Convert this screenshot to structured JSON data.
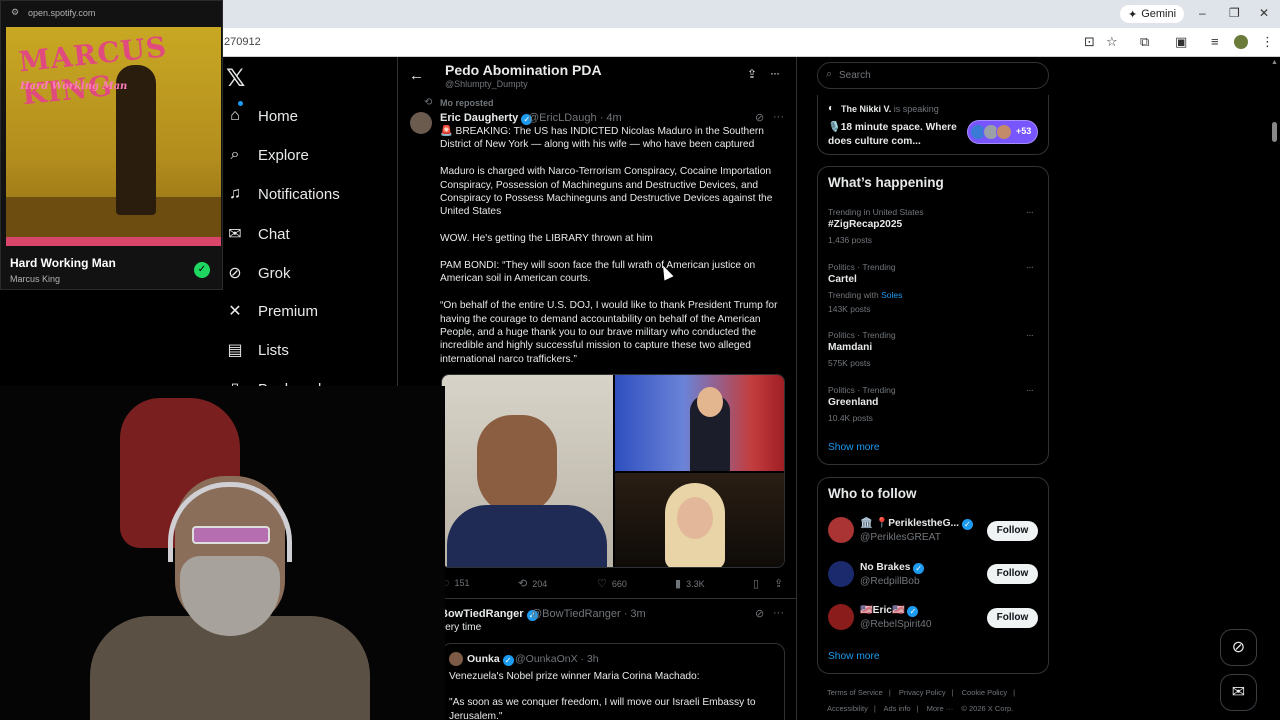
{
  "browser": {
    "url_fragment": "270912",
    "gemini_label": "Gemini",
    "window_controls": [
      "–",
      "❐",
      "✕"
    ]
  },
  "spotify": {
    "url": "open.spotify.com",
    "album_title": "MARCUS KING",
    "album_subtitle": "Hard Working Man",
    "track": "Hard Working Man",
    "artist": "Marcus King"
  },
  "nav": {
    "items": [
      {
        "label": "Home",
        "icon": "home-icon"
      },
      {
        "label": "Explore",
        "icon": "search-icon"
      },
      {
        "label": "Notifications",
        "icon": "bell-icon"
      },
      {
        "label": "Chat",
        "icon": "mail-icon"
      },
      {
        "label": "Grok",
        "icon": "grok-icon"
      },
      {
        "label": "Premium",
        "icon": "x-icon"
      },
      {
        "label": "Lists",
        "icon": "list-icon"
      },
      {
        "label": "Bookmarks",
        "icon": "bookmark-icon"
      }
    ]
  },
  "header": {
    "title": "Pedo Abomination PDA",
    "handle": "@Shlumpty_Dumpty"
  },
  "tweet1": {
    "repost_label": "Mo reposted",
    "name": "Eric Daugherty",
    "handle": "@EricLDaugh · 4m",
    "paragraphs": [
      "BREAKING: The US has INDICTED Nicolas Maduro in the Southern District of New York — along with his wife — who have been captured",
      "Maduro is charged with Narco-Terrorism Conspiracy, Cocaine Importation Conspiracy, Possession of Machineguns and Destructive Devices, and Conspiracy to Possess Machineguns and Destructive Devices against the United States",
      "WOW. He's getting the LIBRARY thrown at him",
      "PAM BONDI: “They will soon face the full wrath of American justice on American soil in American courts.",
      "“On behalf of the entire U.S. DOJ, I would like to thank President Trump for having the courage to demand accountability on behalf of the American People, and a huge thank you to our brave military who conducted the incredible and highly successful mission to capture these two alleged international narco traffickers.”"
    ],
    "stats": {
      "replies": "151",
      "reposts": "204",
      "likes": "660",
      "views": "3.3K"
    }
  },
  "tweet2": {
    "name": "BowTiedRanger",
    "handle": "@BowTiedRanger · 3m",
    "text": "very time",
    "quote": {
      "name": "Ounka",
      "handle": "@OunkaOnX · 3h",
      "line1": "Venezuela's Nobel prize winner Maria Corina Machado:",
      "line2": "\"As soon as we conquer freedom, I will move our Israeli Embassy to Jerusalem.\""
    }
  },
  "search": {
    "placeholder": "Search"
  },
  "space": {
    "host": "The Nikki V.",
    "host_suffix": "is speaking",
    "title": "18 minute space. Where does culture com...",
    "count": "+53"
  },
  "trends": {
    "title": "What’s happening",
    "items": [
      {
        "meta": "Trending in United States",
        "name": "#ZigRecap2025",
        "posts": "1,436 posts"
      },
      {
        "meta": "Politics · Trending",
        "name": "Cartel",
        "with_prefix": "Trending with",
        "with_link": "Soles",
        "posts": "143K posts"
      },
      {
        "meta": "Politics · Trending",
        "name": "Mamdani",
        "posts": "575K posts"
      },
      {
        "meta": "Politics · Trending",
        "name": "Greenland",
        "posts": "10.4K posts"
      }
    ],
    "show_more": "Show more"
  },
  "who_to_follow": {
    "title": "Who to follow",
    "follow_label": "Follow",
    "items": [
      {
        "name": "🏛️ 📍PeriklestheG...",
        "handle": "@PeriklesGREAT",
        "color": "#a33"
      },
      {
        "name": "No Brakes",
        "handle": "@RedpillBob",
        "color": "#1a2a6c"
      },
      {
        "name": "🇺🇸Eric🇺🇸",
        "handle": "@RebelSpirit40",
        "color": "#8b1c1c"
      }
    ],
    "show_more": "Show more"
  },
  "footer": {
    "links": [
      "Terms of Service",
      "Privacy Policy",
      "Cookie Policy",
      "Accessibility",
      "Ads info",
      "More ···",
      "© 2026 X Corp."
    ]
  },
  "colors": {
    "accent": "#1d9bf0",
    "bg": "#000000",
    "spotify_green": "#1ed760"
  }
}
